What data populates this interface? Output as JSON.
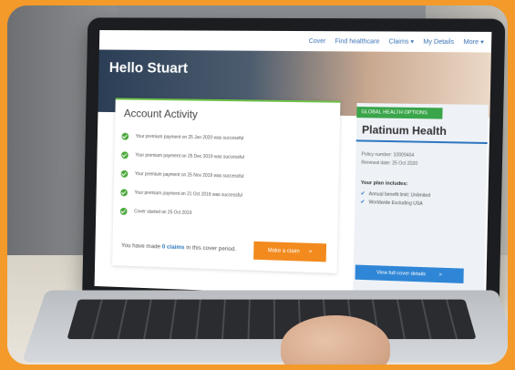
{
  "nav": {
    "cover": "Cover",
    "find": "Find healthcare",
    "claims": "Claims",
    "details": "My Details",
    "more": "More"
  },
  "hero": {
    "title": "Hello Stuart"
  },
  "activity": {
    "title": "Account Activity",
    "items": [
      "Your premium payment on 25 Jan 2020 was successful",
      "Your premium payment on 25 Dec 2019 was successful",
      "Your premium payment on 25 Nov 2019 was successful",
      "Your premium payment on 21 Oct 2019 was successful",
      "Cover started on 25 Oct 2019"
    ],
    "claims_prefix": "You have made",
    "claims_count": "0 claims",
    "claims_suffix": "in this cover period.",
    "claim_button": "Make a claim",
    "claim_arrow": ">"
  },
  "plan": {
    "ribbon": "GLOBAL HEALTH OPTIONS",
    "name": "Platinum Health",
    "policy": "Policy number: 10009404",
    "renewal": "Renewal date: 25 Oct 2020",
    "includes_title": "Your plan includes:",
    "includes": [
      "Annual benefit limit: Unlimited",
      "Worldwide Excluding USA"
    ],
    "view_button": "View full cover details",
    "view_arrow": ">"
  },
  "colors": {
    "frame": "#f39a2a",
    "accent": "#2f77c0",
    "success": "#4ba83c",
    "cta": "#f28a1e"
  }
}
